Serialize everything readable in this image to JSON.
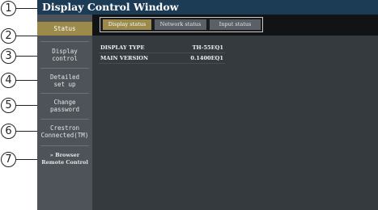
{
  "window": {
    "title": "Display Control Window"
  },
  "callouts": [
    "1",
    "2",
    "3",
    "4",
    "5",
    "6",
    "7"
  ],
  "sidebar": {
    "items": [
      {
        "label_lines": [
          "Status"
        ]
      },
      {
        "label_lines": [
          "Display",
          "control"
        ]
      },
      {
        "label_lines": [
          "Detailed",
          "set up"
        ]
      },
      {
        "label_lines": [
          "Change",
          "password"
        ]
      },
      {
        "label_lines": [
          "Crestron",
          "Connected(TM)"
        ]
      },
      {
        "label_lines": [
          "» Browser",
          "Remote Control"
        ]
      }
    ]
  },
  "tabs": [
    {
      "label": "Display status"
    },
    {
      "label": "Network status"
    },
    {
      "label": "Input status"
    }
  ],
  "info": [
    {
      "label": "DISPLAY TYPE",
      "value": "TH-55EQ1"
    },
    {
      "label": "MAIN VERSION",
      "value": "0.1400EQ1"
    }
  ]
}
